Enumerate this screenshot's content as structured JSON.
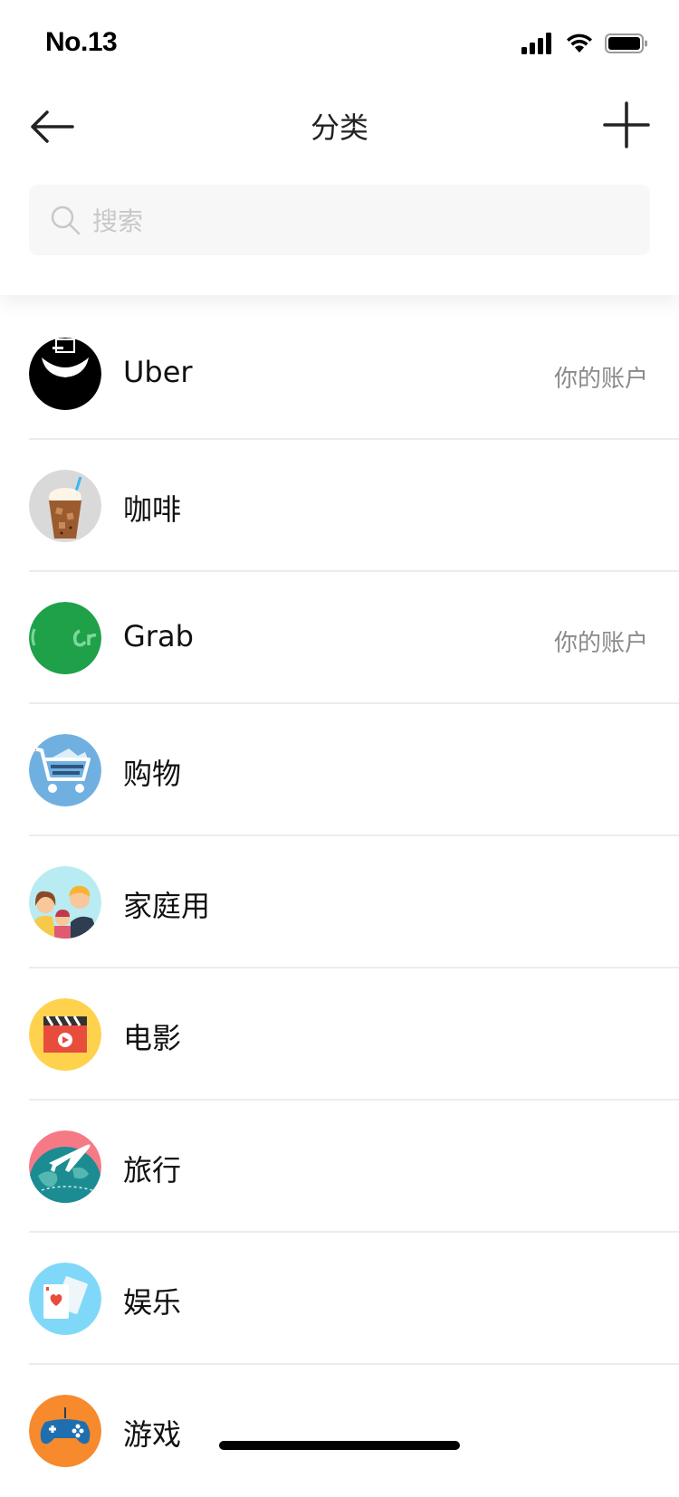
{
  "status_bar": {
    "time": "No.13"
  },
  "header": {
    "title": "分类",
    "back_icon": "arrow-left-icon",
    "add_icon": "plus-icon"
  },
  "search": {
    "placeholder": "搜索",
    "icon": "search-icon"
  },
  "categories": [
    {
      "label": "Uber",
      "right_text": "你的账户",
      "icon": "uber-logo-icon"
    },
    {
      "label": "咖啡",
      "right_text": "",
      "icon": "iced-coffee-icon"
    },
    {
      "label": "Grab",
      "right_text": "你的账户",
      "icon": "grab-logo-icon"
    },
    {
      "label": "购物",
      "right_text": "",
      "icon": "shopping-cart-icon"
    },
    {
      "label": "家庭用",
      "right_text": "",
      "icon": "family-icon"
    },
    {
      "label": "电影",
      "right_text": "",
      "icon": "clapperboard-icon"
    },
    {
      "label": "旅行",
      "right_text": "",
      "icon": "airplane-globe-icon"
    },
    {
      "label": "娱乐",
      "right_text": "",
      "icon": "playing-cards-icon"
    },
    {
      "label": "游戏",
      "right_text": "",
      "icon": "gamepad-icon"
    }
  ],
  "colors": {
    "divider": "#ececec",
    "search_bg": "#f7f7f7",
    "secondary_text": "#8a8a8a",
    "grab_green": "#1fa14a",
    "shopping_blue": "#6fb0e0",
    "family_cyan": "#b8ecf2",
    "movie_yellow": "#ffd24d",
    "travel_pink": "#f57a86",
    "ent_blue": "#80d8f8",
    "game_orange": "#f68a2c"
  }
}
